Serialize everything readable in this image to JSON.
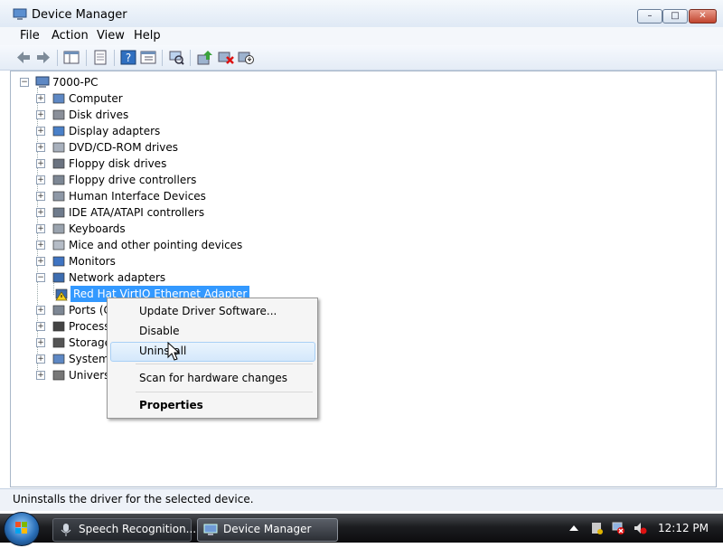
{
  "window": {
    "title": "Device Manager"
  },
  "caption_buttons": {
    "minimize": "–",
    "maximize": "□",
    "close": "✕"
  },
  "menu": [
    "File",
    "Action",
    "View",
    "Help"
  ],
  "tree": {
    "root": "7000-PC",
    "nodes": [
      {
        "label": "Computer",
        "icon": "computer-icon",
        "expander": "+"
      },
      {
        "label": "Disk drives",
        "icon": "disk-icon",
        "expander": "+"
      },
      {
        "label": "Display adapters",
        "icon": "display-icon",
        "expander": "+"
      },
      {
        "label": "DVD/CD-ROM drives",
        "icon": "dvd-icon",
        "expander": "+"
      },
      {
        "label": "Floppy disk drives",
        "icon": "floppy-icon",
        "expander": "+"
      },
      {
        "label": "Floppy drive controllers",
        "icon": "controller-icon",
        "expander": "+"
      },
      {
        "label": "Human Interface Devices",
        "icon": "hid-icon",
        "expander": "+"
      },
      {
        "label": "IDE ATA/ATAPI controllers",
        "icon": "ide-icon",
        "expander": "+"
      },
      {
        "label": "Keyboards",
        "icon": "keyboard-icon",
        "expander": "+"
      },
      {
        "label": "Mice and other pointing devices",
        "icon": "mouse-icon",
        "expander": "+"
      },
      {
        "label": "Monitors",
        "icon": "monitor-icon",
        "expander": "+"
      },
      {
        "label": "Network adapters",
        "icon": "network-icon",
        "expander": "−"
      },
      {
        "label": "Red Hat VirtIO Ethernet Adapter",
        "icon": "warning-adapter-icon",
        "selected": true
      },
      {
        "label": "Ports (C",
        "icon": "port-icon",
        "expander": "+"
      },
      {
        "label": "Processo",
        "icon": "processor-icon",
        "expander": "+"
      },
      {
        "label": "Storage",
        "icon": "storage-icon",
        "expander": "+"
      },
      {
        "label": "System",
        "icon": "system-icon",
        "expander": "+"
      },
      {
        "label": "Universa",
        "icon": "usb-icon",
        "expander": "+"
      }
    ]
  },
  "context_menu": {
    "items": [
      "Update Driver Software...",
      "Disable",
      "Uninstall",
      "Scan for hardware changes",
      "Properties"
    ],
    "hovered": "Uninstall"
  },
  "status": "Uninstalls the driver for the selected device.",
  "taskbar": {
    "tasks": [
      "Speech Recognition...",
      "Device Manager"
    ],
    "active": "Device Manager",
    "clock": "12:12 PM"
  }
}
